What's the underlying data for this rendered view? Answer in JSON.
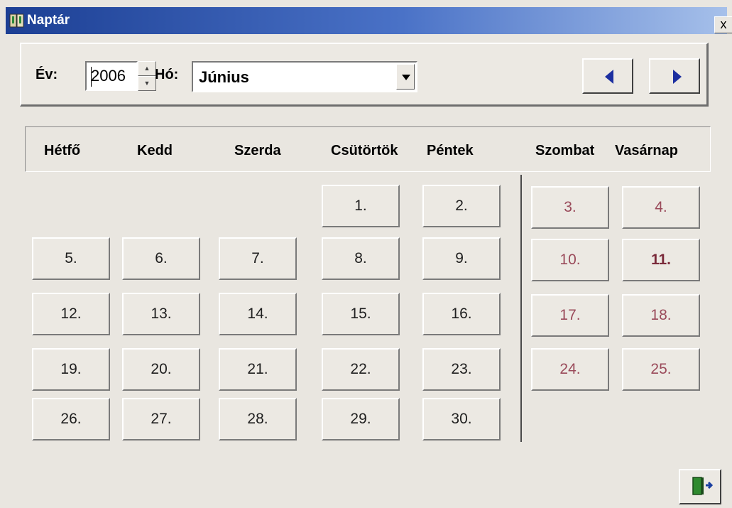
{
  "window": {
    "title": "Naptár",
    "close_label": "x"
  },
  "toolbar": {
    "year_label": "Év:",
    "year_value": "2006",
    "month_label": "Hó:",
    "month_value": "Június",
    "prev_icon": "triangle-left-icon",
    "next_icon": "triangle-right-icon"
  },
  "weekdays": [
    "Hétfő",
    "Kedd",
    "Szerda",
    "Csütörtök",
    "Péntek",
    "Szombat",
    "Vasárnap"
  ],
  "days": [
    {
      "label": "1."
    },
    {
      "label": "2."
    },
    {
      "label": "3."
    },
    {
      "label": "4."
    },
    {
      "label": "5."
    },
    {
      "label": "6."
    },
    {
      "label": "7."
    },
    {
      "label": "8."
    },
    {
      "label": "9."
    },
    {
      "label": "10."
    },
    {
      "label": "11."
    },
    {
      "label": "12."
    },
    {
      "label": "13."
    },
    {
      "label": "14."
    },
    {
      "label": "15."
    },
    {
      "label": "16."
    },
    {
      "label": "17."
    },
    {
      "label": "18."
    },
    {
      "label": "19."
    },
    {
      "label": "20."
    },
    {
      "label": "21."
    },
    {
      "label": "22."
    },
    {
      "label": "23."
    },
    {
      "label": "24."
    },
    {
      "label": "25."
    },
    {
      "label": "26."
    },
    {
      "label": "27."
    },
    {
      "label": "28."
    },
    {
      "label": "29."
    },
    {
      "label": "30."
    }
  ],
  "colors": {
    "title_start": "#1c3f94",
    "weekend_text": "#9a4a5a",
    "today_text": "#7a2a3a",
    "nav_arrow": "#1c2fa0"
  },
  "exit_icon": "door-exit-icon"
}
